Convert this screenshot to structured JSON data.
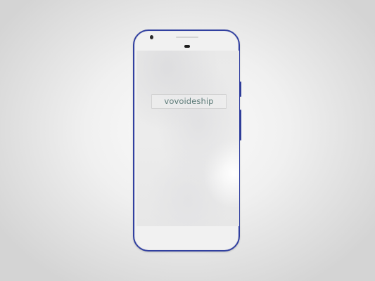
{
  "app": {
    "brand_text": "vovoideship"
  },
  "device": {
    "frame_color": "#3140a0",
    "body_color": "#f1f1f1"
  },
  "colors": {
    "brand_text": "#5c7b78",
    "background": "#f0f0f0"
  }
}
